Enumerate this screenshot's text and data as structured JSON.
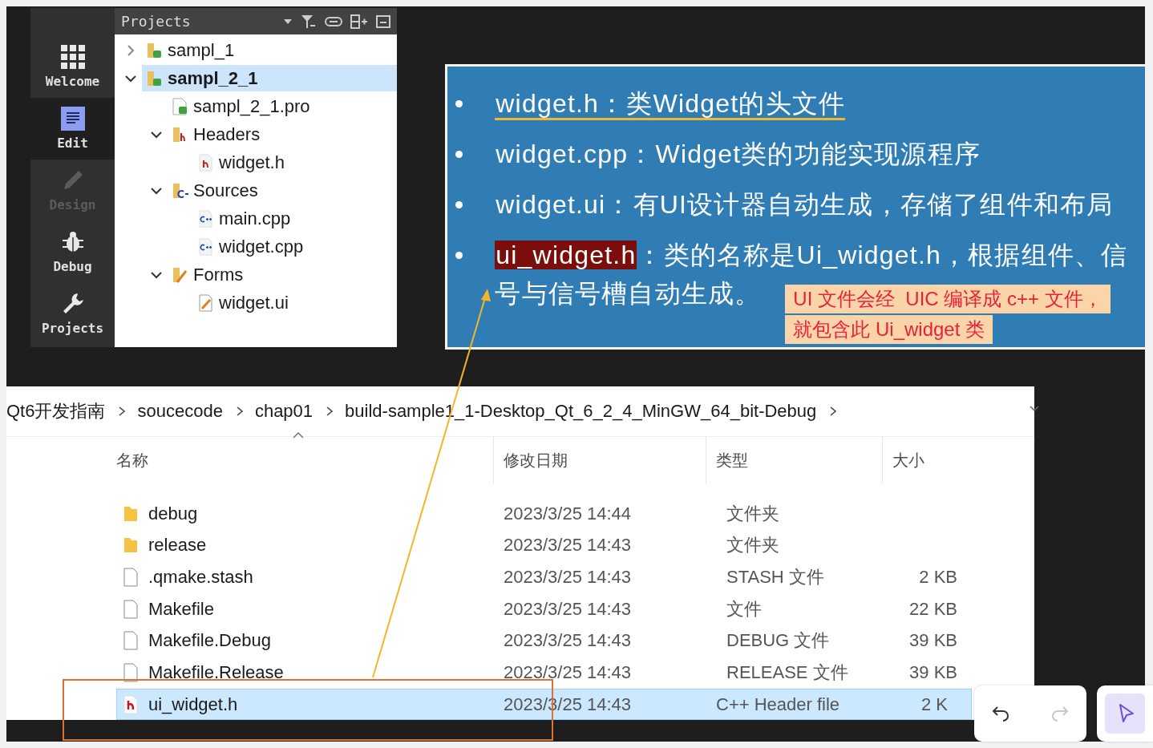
{
  "ide": {
    "modes": [
      {
        "kind": "welcome",
        "label": "Welcome",
        "selected": false,
        "disabled": false
      },
      {
        "kind": "edit",
        "label": "Edit",
        "selected": true,
        "disabled": false
      },
      {
        "kind": "design",
        "label": "Design",
        "selected": false,
        "disabled": true
      },
      {
        "kind": "debug",
        "label": "Debug",
        "selected": false,
        "disabled": false
      },
      {
        "kind": "projects",
        "label": "Projects",
        "selected": false,
        "disabled": false
      }
    ],
    "panel": {
      "title": "Projects"
    },
    "tree": [
      {
        "kind": "project",
        "label": "sampl_1",
        "expanded": false,
        "selected": false
      },
      {
        "kind": "project",
        "label": "sampl_2_1",
        "expanded": true,
        "selected": true,
        "children": [
          {
            "kind": "pro",
            "label": "sampl_2_1.pro",
            "selected": false
          },
          {
            "kind": "headers",
            "label": "Headers",
            "expanded": true,
            "selected": false,
            "children": [
              {
                "kind": "header",
                "label": "widget.h",
                "selected": false
              }
            ]
          },
          {
            "kind": "sources",
            "label": "Sources",
            "expanded": true,
            "selected": false,
            "children": [
              {
                "kind": "cpp",
                "label": "main.cpp",
                "selected": false
              },
              {
                "kind": "cpp",
                "label": "widget.cpp",
                "selected": false
              }
            ]
          },
          {
            "kind": "forms",
            "label": "Forms",
            "expanded": true,
            "selected": false,
            "children": [
              {
                "kind": "ui",
                "label": "widget.ui",
                "selected": false
              }
            ]
          }
        ]
      }
    ]
  },
  "slide": {
    "bullets": [
      {
        "term": "widget.h：",
        "text": "类Widget的头文件",
        "underlined": true,
        "highlighted": false
      },
      {
        "term": "widget.cpp：",
        "text": "Widget类的功能实现源程序",
        "underlined": false,
        "highlighted": false
      },
      {
        "term": "widget.ui：",
        "text": "有UI设计器自动生成，存储了组件和布局",
        "underlined": false,
        "highlighted": false
      },
      {
        "term": "ui_widget.h",
        "text": "：类的名称是Ui_widget.h，根据组件、信号与信号槽自动生成。",
        "underlined": false,
        "highlighted": true
      }
    ],
    "note": [
      "UI 文件会经  UIC 编译成 c++ 文件，",
      "就包含此 Ui_widget 类"
    ]
  },
  "explorer": {
    "breadcrumb": [
      "Qt6开发指南",
      "soucecode",
      "chap01",
      "build-sample1_1-Desktop_Qt_6_2_4_MinGW_64_bit-Debug"
    ],
    "columns": [
      "名称",
      "修改日期",
      "类型",
      "大小"
    ],
    "rows": [
      {
        "kind": "folder",
        "name": "debug",
        "date": "2023/3/25 14:44",
        "type": "文件夹",
        "selected": false
      },
      {
        "kind": "folder",
        "name": "release",
        "date": "2023/3/25 14:43",
        "type": "文件夹",
        "selected": false
      },
      {
        "kind": "file",
        "name": ".qmake.stash",
        "date": "2023/3/25 14:43",
        "type": "STASH 文件",
        "size": "2 KB",
        "selected": false
      },
      {
        "kind": "file",
        "name": "Makefile",
        "date": "2023/3/25 14:43",
        "type": "文件",
        "size": "22 KB",
        "selected": false
      },
      {
        "kind": "file",
        "name": "Makefile.Debug",
        "date": "2023/3/25 14:43",
        "type": "DEBUG 文件",
        "size": "39 KB",
        "selected": false
      },
      {
        "kind": "file",
        "name": "Makefile.Release",
        "date": "2023/3/25 14:43",
        "type": "RELEASE 文件",
        "size": "39 KB",
        "selected": false
      },
      {
        "kind": "header",
        "name": "ui_widget.h",
        "date": "2023/3/25 14:43",
        "type": "C++ Header file",
        "size": "2 K",
        "selected": true
      }
    ]
  },
  "toolbar": {
    "history": [
      {
        "kind": "undo",
        "disabled": false
      },
      {
        "kind": "redo",
        "disabled": true
      }
    ],
    "tool": {
      "kind": "pointer",
      "selected": true
    }
  }
}
